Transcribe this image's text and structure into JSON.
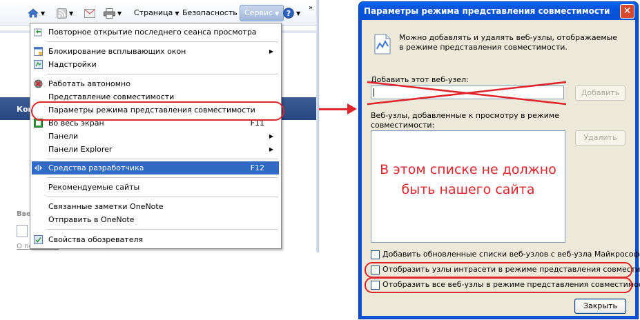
{
  "ie": {
    "toolbar": {
      "home_icon": "home-icon",
      "feeds_icon": "rss-icon",
      "mail_icon": "mail-icon",
      "print_icon": "printer-icon",
      "page_label": "Страница",
      "safety_label": "Безопасность",
      "tools_label": "Сервис",
      "help_icon": "help-icon",
      "more": "»"
    },
    "background": {
      "band_text": "Кон",
      "text1": "Вве",
      "link": "О подписке"
    }
  },
  "menu": {
    "items": [
      {
        "label": "Повторное открытие последнего сеанса просмотра",
        "icon": "reopen-session-icon"
      },
      {
        "label": "Блокирование всплывающих окон",
        "icon": "popup-blocker-icon",
        "submenu": "▶"
      },
      {
        "label": "Надстройки",
        "icon": "addons-icon"
      },
      {
        "label": "Работать автономно",
        "icon": "offline-icon"
      },
      {
        "label": "Представление совместимости"
      },
      {
        "label": "Параметры режима представления совместимости"
      },
      {
        "label": "Во весь экран",
        "icon": "fullscreen-icon",
        "shortcut": "F11"
      },
      {
        "label": "Панели",
        "submenu": "▶"
      },
      {
        "label": "Панели Explorer",
        "submenu": "▶"
      },
      {
        "label": "Средства разработчика",
        "icon": "dev-tools-icon",
        "shortcut": "F12"
      },
      {
        "label": "Рекомендуемые сайты"
      },
      {
        "label": "Связанные заметки OneNote"
      },
      {
        "label": "Отправить в OneNote"
      },
      {
        "label": "Свойства обозревателя",
        "icon": "internet-options-icon"
      }
    ]
  },
  "dialog": {
    "title": "Параметры режима представления совместимости",
    "close": "✕",
    "description": "Можно добавлять и удалять веб-узлы, отображаемые в режиме представления совместимости.",
    "add_label": "Добавить этот веб-узел:",
    "add_value": "",
    "add_button": "Добавить",
    "list_label": "Веб-узлы, добавленные к просмотру в режиме совместимости:",
    "list_note": "В этом списке не должно быть нашего сайта",
    "remove_button": "Удалить",
    "checkboxes": [
      {
        "label": "Добавить обновленные списки веб-узлов с веб-узла Майкрософт",
        "checked": false
      },
      {
        "label": "Отобразить узлы интрасети в режиме представления совместимости",
        "checked": false
      },
      {
        "label": "Отобразить все веб-узлы в режиме представления совместимости",
        "checked": false
      }
    ],
    "close_button": "Закрыть"
  },
  "colors": {
    "annotation_red": "#e0242c",
    "menu_highlight": "#316ac5",
    "xp_title_blue": "#0754dc",
    "dialog_face": "#ece9d8"
  }
}
